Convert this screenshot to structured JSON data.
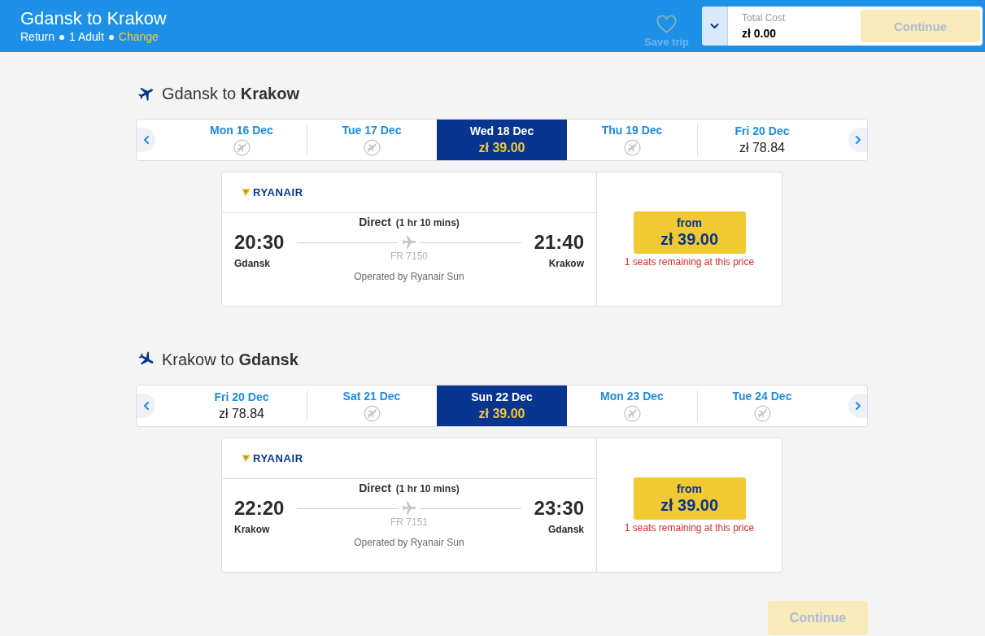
{
  "header": {
    "title": "Gdansk to Krakow",
    "trip_summary": [
      "Return",
      "1 Adult"
    ],
    "change_link": "Change",
    "save_trip": "Save trip",
    "total": {
      "label": "Total Cost",
      "value": "zł 0.00"
    },
    "continue": {
      "label": "Continue",
      "disabled": true
    }
  },
  "journeys": [
    {
      "kind": "outbound",
      "title": "Gdansk to **Krakow**",
      "dates": [
        {
          "day": "Mon 16 Dec",
          "available": false,
          "selected": false
        },
        {
          "day": "Tue 17 Dec",
          "available": false,
          "selected": false
        },
        {
          "day": "Wed 18 Dec",
          "available": true,
          "price": "zł 39.00",
          "selected": true
        },
        {
          "day": "Thu 19 Dec",
          "available": false,
          "selected": false
        },
        {
          "day": "Fri 20 Dec",
          "available": true,
          "price": "zł 78.84",
          "selected": false
        }
      ],
      "flight": {
        "airline": "RYANAIR",
        "stops": "Direct",
        "duration": "(1 hr 10 mins)",
        "departure": {
          "time": "20:30",
          "city": "Gdansk"
        },
        "arrival": {
          "time": "21:40",
          "city": "Krakow"
        },
        "flight_number": "FR 7150",
        "operator": "Operated by Ryanair Sun",
        "fare": {
          "label": "from",
          "price": "zł 39.00"
        },
        "seats_note": "1 seats remaining at this price"
      }
    },
    {
      "kind": "inbound",
      "title": "Krakow to **Gdansk**",
      "dates": [
        {
          "day": "Fri 20 Dec",
          "available": true,
          "price": "zł 78.84",
          "selected": false
        },
        {
          "day": "Sat 21 Dec",
          "available": false,
          "selected": false
        },
        {
          "day": "Sun 22 Dec",
          "available": true,
          "price": "zł 39.00",
          "selected": true
        },
        {
          "day": "Mon 23 Dec",
          "available": false,
          "selected": false
        },
        {
          "day": "Tue 24 Dec",
          "available": false,
          "selected": false
        }
      ],
      "flight": {
        "airline": "RYANAIR",
        "stops": "Direct",
        "duration": "(1 hr 10 mins)",
        "departure": {
          "time": "22:20",
          "city": "Krakow"
        },
        "arrival": {
          "time": "23:30",
          "city": "Gdansk"
        },
        "flight_number": "FR 7151",
        "operator": "Operated by Ryanair Sun",
        "fare": {
          "label": "from",
          "price": "zł 39.00"
        },
        "seats_note": "1 seats remaining at this price"
      }
    }
  ],
  "continue": {
    "label": "Continue",
    "disabled": true
  }
}
